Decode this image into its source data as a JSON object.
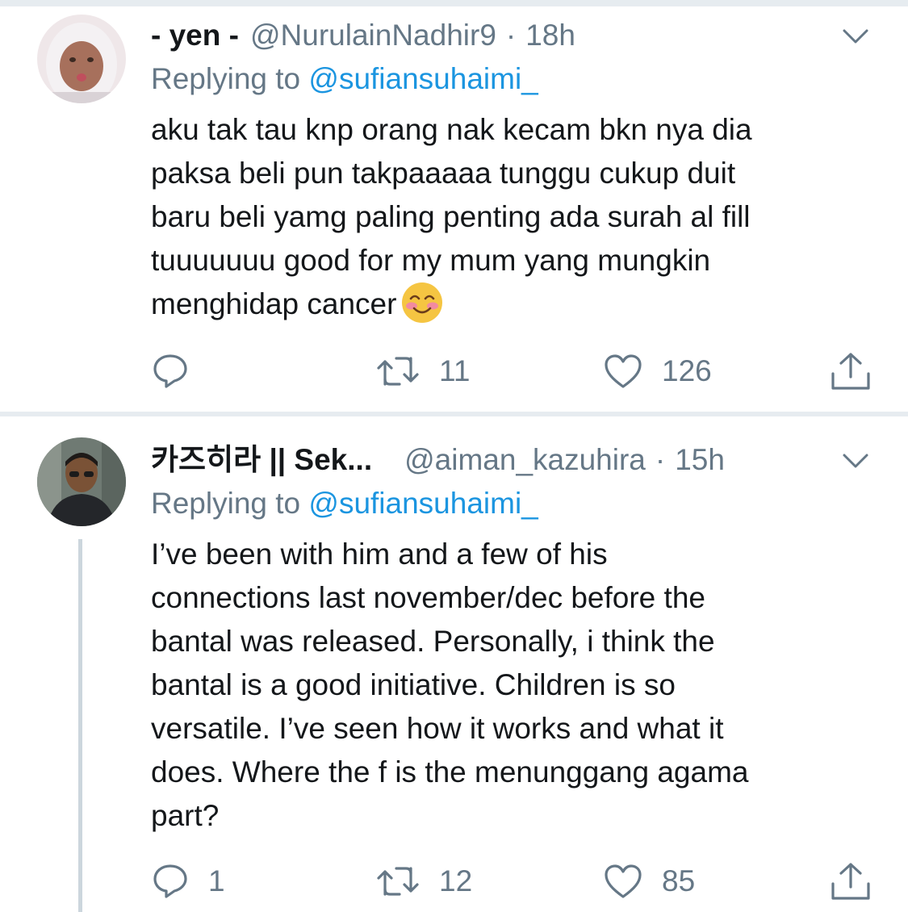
{
  "tweets": [
    {
      "display_name": "- yen -",
      "handle": "@NurulainNadhir9",
      "separator": "·",
      "time": "18h",
      "replying_prefix": "Replying to",
      "replying_to": "@sufiansuhaimi_",
      "text": "aku tak tau knp orang nak kecam bkn nya dia\npaksa beli pun takpaaaaa tunggu cukup duit\nbaru beli yamg paling penting ada surah al fill\ntuuuuuuu good for my mum yang mungkin\nmenghidap cancer",
      "emoji": "smiling-face-with-blushing-cheeks",
      "reply_count": "",
      "retweet_count": "11",
      "like_count": "126"
    },
    {
      "display_name": "카즈히라 || Sek...",
      "handle": "@aiman_kazuhira",
      "separator": "·",
      "time": "15h",
      "replying_prefix": "Replying to",
      "replying_to": "@sufiansuhaimi_",
      "text": "I’ve been with him and a few of his\nconnections last november/dec before the\nbantal was released. Personally, i think the\nbantal is a good initiative. Children is so\nversatile. I’ve seen how it works and what it\ndoes. Where the f is the menunggang agama\npart?",
      "reply_count": "1",
      "retweet_count": "12",
      "like_count": "85"
    }
  ],
  "colors": {
    "text_primary": "#14171a",
    "text_secondary": "#657786",
    "mention": "#1b95e0",
    "divider": "#e6ecf0",
    "thread_line": "#ccd6dd"
  }
}
